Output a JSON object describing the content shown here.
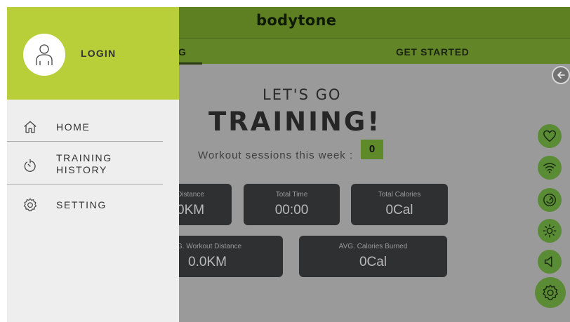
{
  "app": {
    "brand": "bodytone"
  },
  "tabs": {
    "training_partial": "G",
    "get_started": "GET STARTED"
  },
  "main": {
    "lets_go": "LET'S GO",
    "training": "TRAINING!",
    "sessions_label": "Workout sessions this week :",
    "sessions_count": "0"
  },
  "cards": [
    {
      "label": "Distance",
      "value": "0KM"
    },
    {
      "label": "Total Time",
      "value": "00:00"
    },
    {
      "label": "Total Calories",
      "value": "0Cal"
    },
    {
      "label": "G. Workout Distance",
      "value": "0.0KM"
    },
    {
      "label": "AVG. Calories Burned",
      "value": "0Cal"
    }
  ],
  "drawer": {
    "login": "LOGIN",
    "items": [
      {
        "label": "HOME",
        "icon": "home-icon"
      },
      {
        "label": "TRAINING HISTORY",
        "icon": "history-icon"
      },
      {
        "label": "SETTING",
        "icon": "gear-icon"
      }
    ]
  },
  "controls": [
    "heart-icon",
    "wifi-icon",
    "speed-icon",
    "brightness-icon",
    "sound-icon",
    "gear-icon"
  ],
  "colors": {
    "drawer_header": "#b8cf3a",
    "topbar": "#5e8023",
    "control_green": "#5a8b35",
    "card_bg": "#2e3032"
  }
}
